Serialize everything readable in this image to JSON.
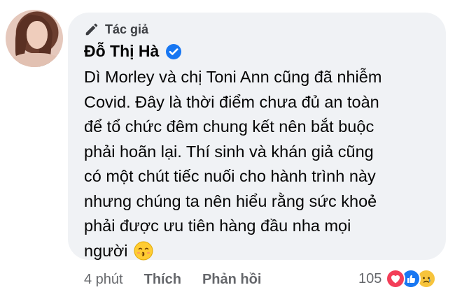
{
  "comment": {
    "author_badge": "Tác giả",
    "author_name": "Đỗ Thị Hà",
    "text_lines": [
      "Dì Morley và chị Toni Ann cũng đã nhiễm",
      "Covid. Đây là thời điểm chưa đủ an toàn",
      "để tổ chức đêm chung kết nên bắt buộc",
      "phải hoãn lại. Thí sinh và khán giả cũng",
      "có một chút tiếc nuối cho hành trình này",
      "nhưng chúng ta nên hiểu rằng sức khoẻ",
      "phải được ưu tiên hàng đầu nha mọi",
      "người"
    ],
    "trailing_emoji": "kissing-face-with-smiling-eyes-icon"
  },
  "actions": {
    "time": "4 phút",
    "like_label": "Thích",
    "reply_label": "Phản hồi"
  },
  "reactions": {
    "count": "105",
    "types": [
      "love-icon",
      "like-icon",
      "sad-icon"
    ]
  },
  "colors": {
    "bubble_bg": "#f0f2f5",
    "verified_blue": "#1877f2",
    "secondary_text": "#65676b"
  }
}
